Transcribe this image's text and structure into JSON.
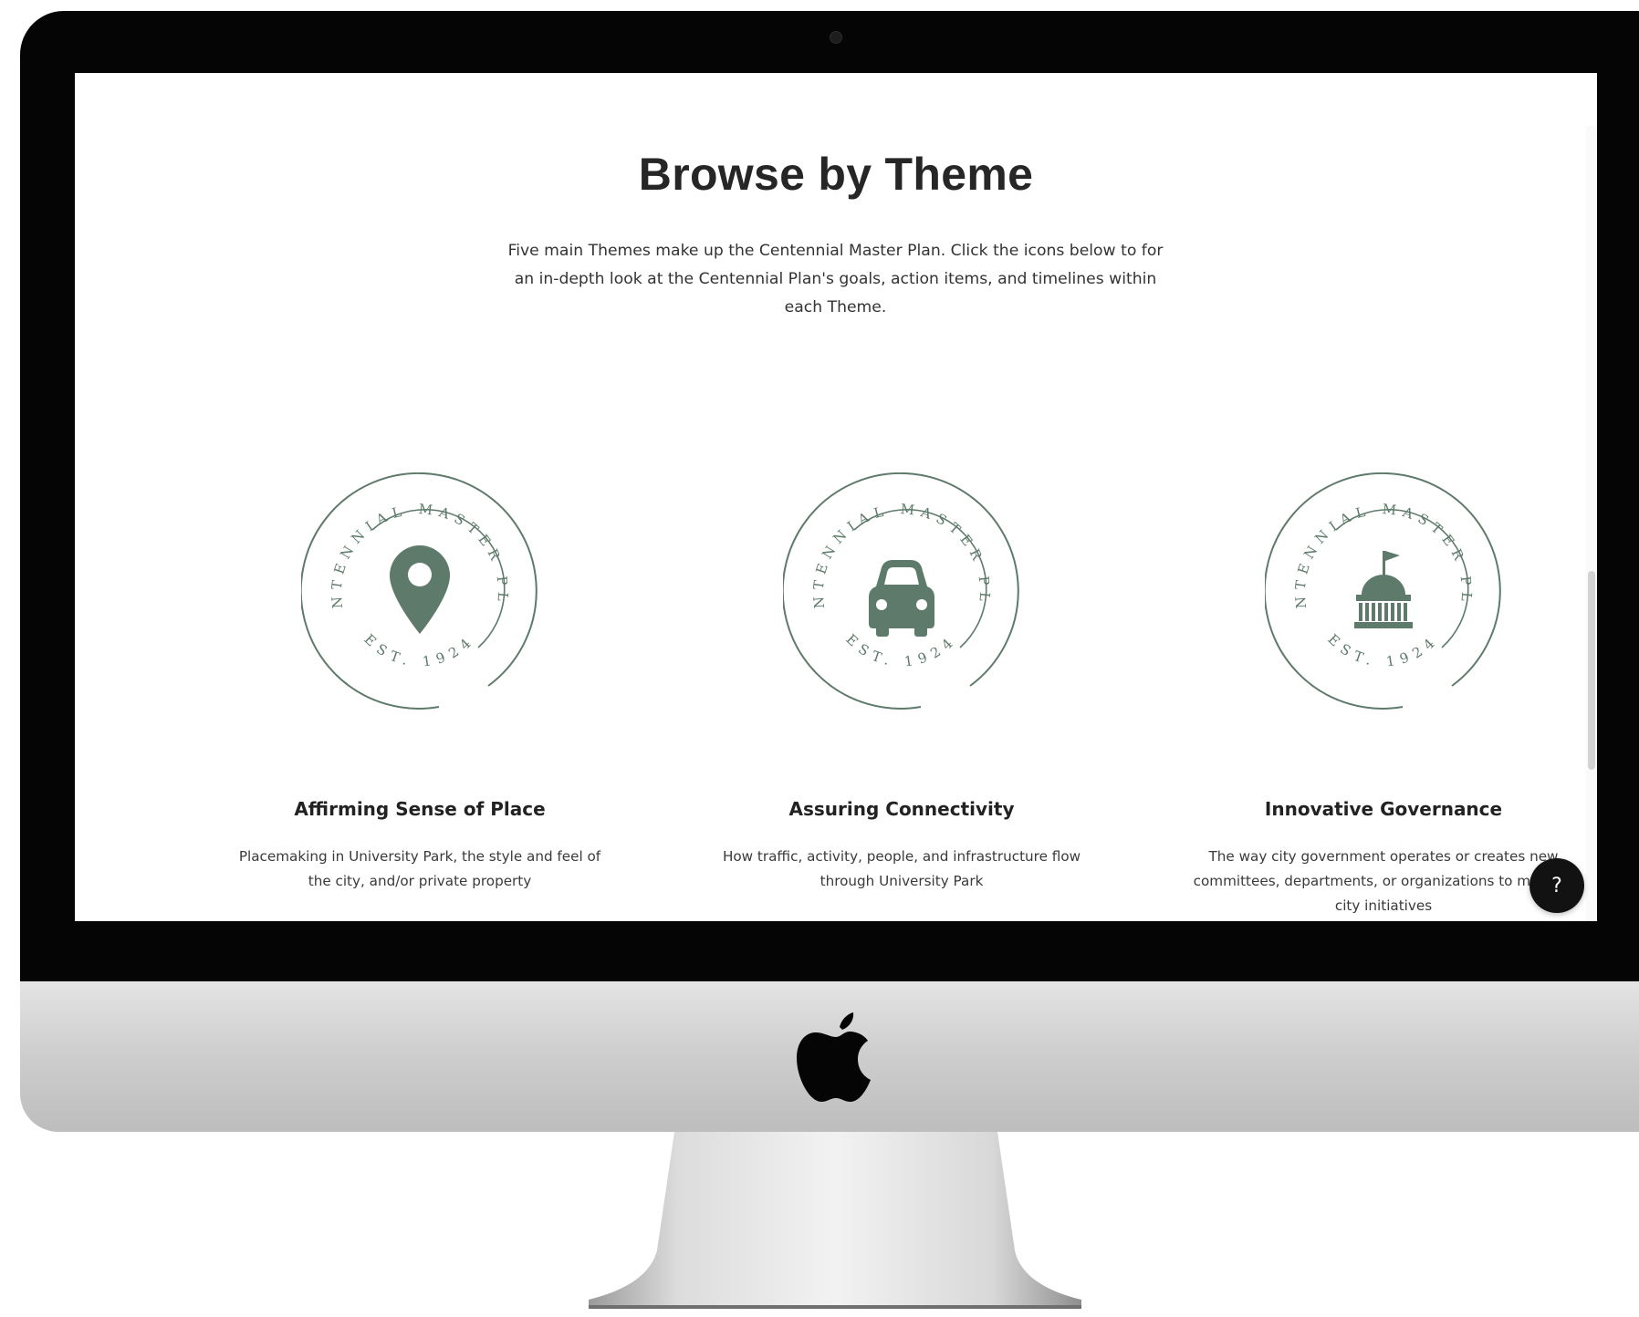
{
  "page": {
    "heading": "Browse by Theme",
    "intro": "Five main Themes make up the Centennial Master Plan. Click the icons below to for an in-depth look at the Centennial Plan's goals, action items, and timelines within each Theme."
  },
  "emblem": {
    "ring_text": "CENTENNIAL MASTER PLAN",
    "est_text": "EST. 1924"
  },
  "themes": [
    {
      "title": "Affirming Sense of Place",
      "description": "Placemaking in University Park, the style and feel of the city, and/or private property",
      "icon": "map-pin-icon"
    },
    {
      "title": "Assuring Connectivity",
      "description": "How traffic, activity, people, and infrastructure flow through University Park",
      "icon": "car-icon"
    },
    {
      "title": "Innovative Governance",
      "description": "The way city government operates or creates new committees, departments, or organizations to manage city initiatives",
      "icon": "capitol-building-icon"
    }
  ],
  "help_button": {
    "label": "?"
  },
  "colors": {
    "emblem_green": "#5e7a6a",
    "heading": "#262626",
    "body_text": "#3a3a3a",
    "bezel": "#050505",
    "help_button_bg": "#121212"
  }
}
